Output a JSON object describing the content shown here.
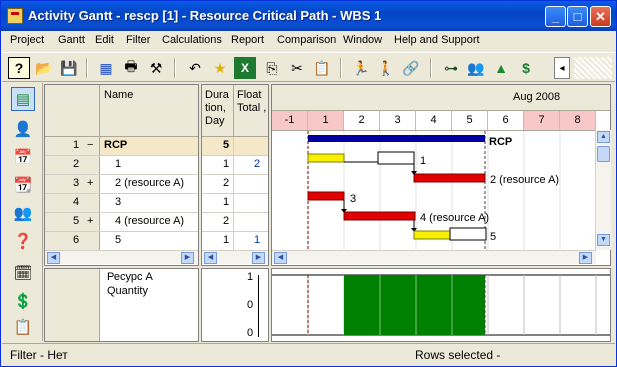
{
  "window": {
    "title": "Activity Gantt - rescp [1] - Resource Critical Path - WBS 1",
    "min_glyph": "_",
    "max_glyph": "□",
    "close_glyph": "✕"
  },
  "menu": [
    "Project",
    "Gantt",
    "Edit",
    "Filter",
    "Calculations",
    "Report",
    "Comparison",
    "Window",
    "Help and Support"
  ],
  "toolbar": {
    "icons": [
      "help-icon",
      "open-folder-icon",
      "save-icon",
      "columns-icon",
      "print-icon",
      "hammer-icon",
      "undo-icon",
      "star-icon",
      "excel-icon",
      "copy-icon",
      "cut-icon",
      "paste-icon",
      "person-run-icon",
      "person-icon",
      "link-icon",
      "link-task-icon",
      "resource-icon",
      "pyramid-icon",
      "cost-icon",
      "scroll-left-icon"
    ],
    "glyphs": [
      "?",
      "📂",
      "💾",
      "▦",
      "🖶",
      "⚒",
      "↶",
      "★",
      "X",
      "⎘",
      "✂",
      "📋",
      "🏃",
      "🚶",
      "🔗",
      "⊶",
      "👥",
      "▲",
      "$",
      "◂"
    ]
  },
  "left_strip": {
    "icons": [
      "gantt-view-icon",
      "resource-person-icon",
      "calendar-alert-icon",
      "calendar-view-icon",
      "resource-group-icon",
      "resource-question-icon",
      "calendar-check-icon",
      "calendar-cost-icon",
      "calendar-list-icon"
    ],
    "glyphs": [
      "▤",
      "👤",
      "📅",
      "📆",
      "👥",
      "❓",
      "🗓",
      "💲",
      "📋"
    ]
  },
  "table": {
    "col_name": "Name",
    "col_duration": "Dura tion, Day",
    "col_float": "Float Total ,",
    "rows": [
      {
        "num": "1",
        "exp": "−",
        "name": "RCP",
        "duration": "5",
        "float": ""
      },
      {
        "num": "2",
        "exp": "",
        "name": "1",
        "duration": "1",
        "float": "2"
      },
      {
        "num": "3",
        "exp": "+",
        "name": "2 (resource A)",
        "duration": "2",
        "float": ""
      },
      {
        "num": "4",
        "exp": "",
        "name": "3",
        "duration": "1",
        "float": ""
      },
      {
        "num": "5",
        "exp": "+",
        "name": "4 (resource A)",
        "duration": "2",
        "float": ""
      },
      {
        "num": "6",
        "exp": "",
        "name": "5",
        "duration": "1",
        "float": "1"
      }
    ]
  },
  "gantt": {
    "month": "Aug 2008",
    "days": [
      "-1",
      "1",
      "2",
      "3",
      "4",
      "5",
      "6",
      "7",
      "8"
    ],
    "weekend_days": [
      "-1",
      "1",
      "7",
      "8"
    ],
    "bar_labels": [
      "RCP",
      "1",
      "2 (resource A)",
      "3",
      "4 (resource A)",
      "5"
    ],
    "colors": {
      "summary": "#0000a0",
      "critical": "#e00000",
      "noncritical": "#f8f000",
      "resource_fill": "#008000",
      "weekend_header": "#f8c8c8"
    }
  },
  "resource": {
    "name": "Ресурс A",
    "quantity_label": "Quantity",
    "axis": [
      "1",
      "0",
      "0"
    ]
  },
  "status": {
    "filter": "Filter -  Нет",
    "rows_selected": "Rows selected  -"
  }
}
